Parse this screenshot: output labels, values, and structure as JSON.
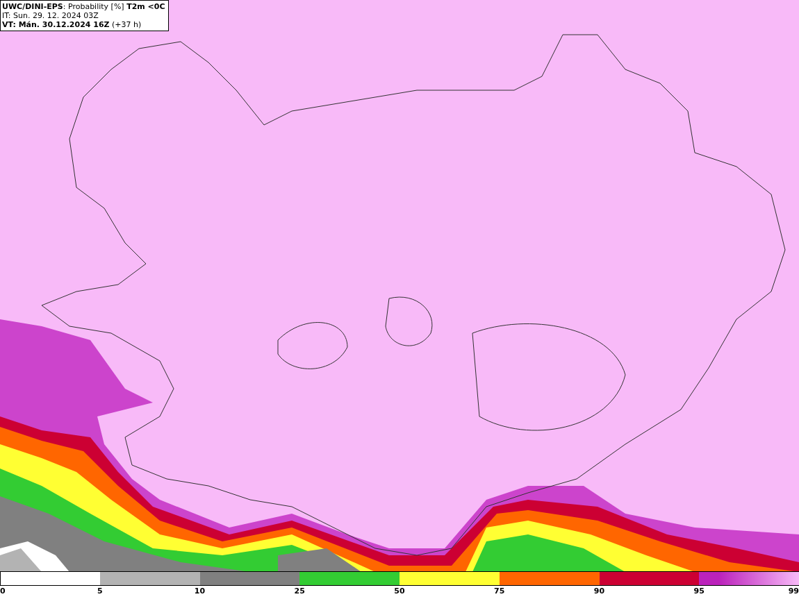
{
  "title_box": {
    "lines": [
      "**UWC/DINI-EPS**: Probability [%] **T2m <0C**",
      "IT: Sun. 29. 12. 2024 03Z",
      "**VT: Mán. 30.12.2024 16Z** (+37 h)"
    ]
  },
  "legend": {
    "segments": [
      {
        "color": "#ffffff"
      },
      {
        "color": "#b3b3b3"
      },
      {
        "color": "#808080"
      },
      {
        "color": "#33cc33"
      },
      {
        "color": "#ffff33"
      },
      {
        "color": "#ff6600"
      },
      {
        "color": "#cc0033"
      },
      {
        "color": "#bb22bb"
      }
    ],
    "ticks": [
      "0",
      "5",
      "10",
      "25",
      "50",
      "75",
      "90",
      "95",
      "99"
    ]
  }
}
